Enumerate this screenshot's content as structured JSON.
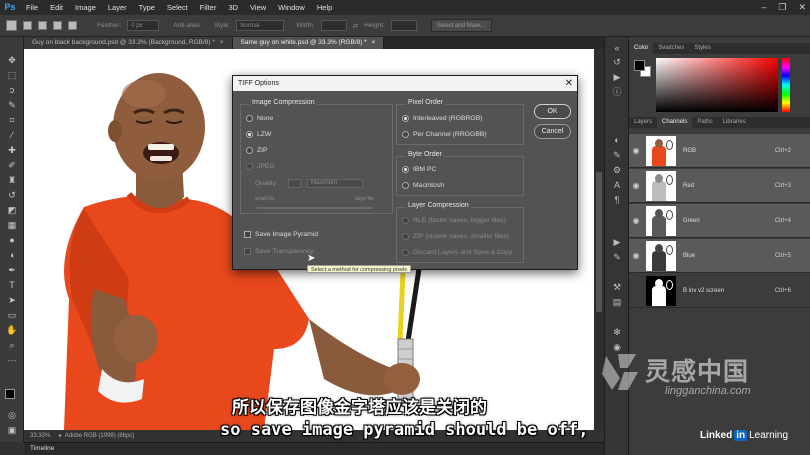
{
  "menubar": {
    "app_logo": "Ps",
    "items": [
      "File",
      "Edit",
      "Image",
      "Layer",
      "Type",
      "Select",
      "Filter",
      "3D",
      "View",
      "Window",
      "Help"
    ],
    "win_minimize": "–",
    "win_restore": "❐",
    "win_close": "✕"
  },
  "options_bar": {
    "feather_label": "Feather:",
    "feather_value": "0 px",
    "antialias_label": "Anti-alias",
    "style_label": "Style:",
    "style_value": "Normal",
    "width_label": "Width:",
    "height_label": "Height:",
    "select_mask_label": "Select and Mask..."
  },
  "doc_tabs": [
    {
      "label": "Guy on black background.psd @ 33.3% (Background, RGB/8) *",
      "close": "×"
    },
    {
      "label": "Same guy on white.psd @ 33.3% (RGB/8) *",
      "close": "×"
    }
  ],
  "status": {
    "zoom": "33.33%",
    "profile": "Adobe RGB (1998) (8bpc)"
  },
  "timeline_label": "Timeline",
  "dialog": {
    "title": "TIFF Options",
    "close": "✕",
    "compression": {
      "title": "Image Compression",
      "options": [
        "None",
        "LZW",
        "ZIP",
        "JPEG"
      ],
      "selected": "LZW",
      "quality_label": "Quality:",
      "quality_select": "Maximum",
      "small_file": "small file",
      "large_file": "large file"
    },
    "pixel_order": {
      "title": "Pixel Order",
      "options": [
        "Interleaved (RGBRGB)",
        "Per Channel (RRGGBB)"
      ],
      "selected": "Interleaved (RGBRGB)"
    },
    "byte_order": {
      "title": "Byte Order",
      "options": [
        "IBM PC",
        "Macintosh"
      ],
      "selected": "IBM PC"
    },
    "layer_compression": {
      "title": "Layer Compression",
      "options": [
        "RLE (faster saves, bigger files)",
        "ZIP (slower saves, smaller files)",
        "Discard Layers and Save a Copy"
      ]
    },
    "save_pyramid": "Save Image Pyramid",
    "save_transparency": "Save Transparency",
    "ok": "OK",
    "cancel": "Cancel"
  },
  "tooltip": "Select a method for compressing pixels",
  "panel": {
    "color_tabs": [
      "Color",
      "Swatches",
      "Styles"
    ],
    "layer_tabs": [
      "Layers",
      "Channels",
      "Paths",
      "Libraries"
    ],
    "channels": [
      {
        "name": "RGB",
        "shortcut": "Ctrl+2"
      },
      {
        "name": "Red",
        "shortcut": "Ctrl+3"
      },
      {
        "name": "Green",
        "shortcut": "Ctrl+4"
      },
      {
        "name": "Blue",
        "shortcut": "Ctrl+5"
      },
      {
        "name": "B inv v2 screen",
        "shortcut": "Ctrl+6"
      }
    ]
  },
  "subtitles": {
    "zh": "所以保存图像金字塔应该是关闭的",
    "en": "so save image pyramid should be off,"
  },
  "watermark": {
    "cn": "灵感中国",
    "url": "lingganchina.com",
    "linkedin_a": "Linked",
    "linkedin_box": "in",
    "linkedin_b": "Learning"
  },
  "colors": {
    "ps_blue": "#31a8ff",
    "shirt_orange": "#e8481c",
    "fg_color": "#000000",
    "bg_color": "#ffffff"
  }
}
